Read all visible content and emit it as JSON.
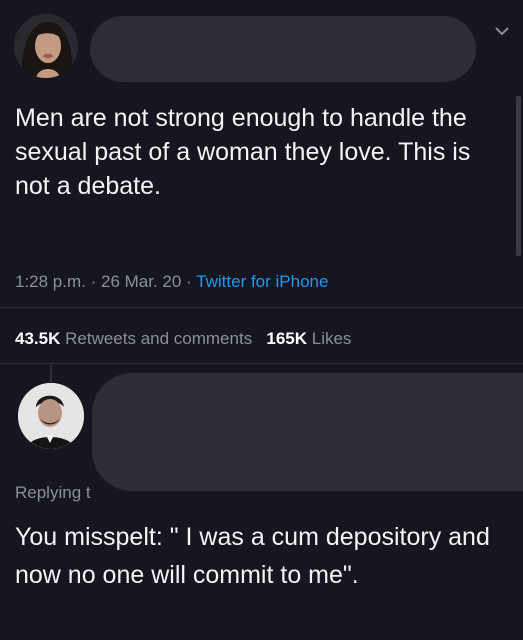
{
  "tweet": {
    "text": "Men are not strong enough to handle the sexual past of a woman they love. This is not a debate.",
    "time": "1:28 p.m.",
    "date": "26 Mar. 20",
    "source": "Twitter for iPhone",
    "separator": "·"
  },
  "stats": {
    "retweets_count": "43.5K",
    "retweets_label": "Retweets and comments",
    "likes_count": "165K",
    "likes_label": "Likes"
  },
  "reply": {
    "replying_prefix": "Replying t",
    "text": "You misspelt: \" I was a cum depository and now no one will commit to me\"."
  },
  "colors": {
    "background": "#15161f",
    "link": "#1d9bf0",
    "muted": "#8b8f99",
    "redaction": "#2d2d36"
  },
  "icons": [
    "chevron-down-icon"
  ]
}
